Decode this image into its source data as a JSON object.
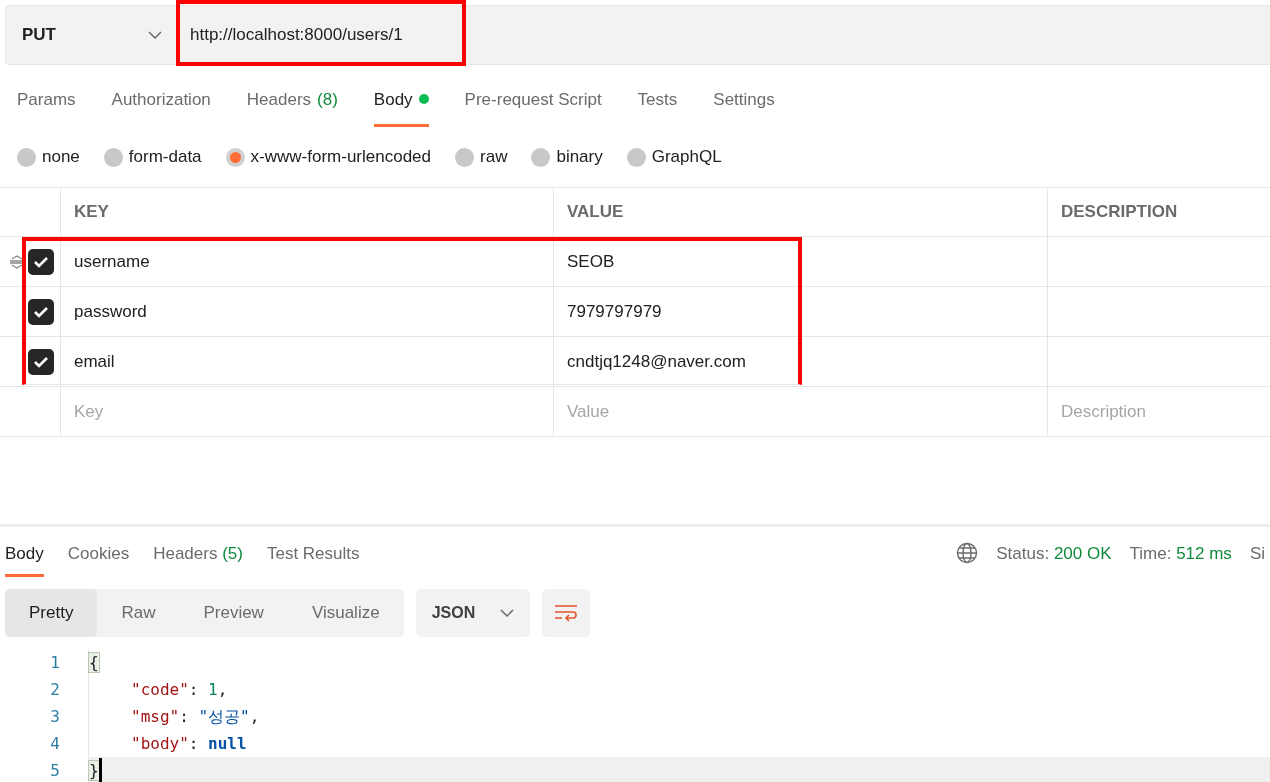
{
  "request": {
    "method": "PUT",
    "url": "http://localhost:8000/users/1",
    "url_highlighted": true
  },
  "request_tabs": [
    {
      "label": "Params",
      "selected": false
    },
    {
      "label": "Authorization",
      "selected": false
    },
    {
      "label": "Headers",
      "count": "(8)",
      "selected": false
    },
    {
      "label": "Body",
      "selected": true,
      "dot": true
    },
    {
      "label": "Pre-request Script",
      "selected": false
    },
    {
      "label": "Tests",
      "selected": false
    },
    {
      "label": "Settings",
      "selected": false
    }
  ],
  "body_types": [
    {
      "label": "none",
      "selected": false
    },
    {
      "label": "form-data",
      "selected": false
    },
    {
      "label": "x-www-form-urlencoded",
      "selected": true
    },
    {
      "label": "raw",
      "selected": false
    },
    {
      "label": "binary",
      "selected": false
    },
    {
      "label": "GraphQL",
      "selected": false
    }
  ],
  "params_table": {
    "columns": [
      "KEY",
      "VALUE",
      "DESCRIPTION"
    ],
    "rows": [
      {
        "key": "username",
        "value": "SEOB",
        "checked": true,
        "highlighted": true,
        "drag_handle": true
      },
      {
        "key": "password",
        "value": "7979797979",
        "checked": true,
        "highlighted": true,
        "drag_handle": false
      },
      {
        "key": "email",
        "value": "cndtjq1248@naver.com",
        "checked": true,
        "highlighted": true,
        "drag_handle": false
      }
    ],
    "new_row": {
      "key_placeholder": "Key",
      "value_placeholder": "Value",
      "description_placeholder": "Description"
    }
  },
  "response_tabs": [
    {
      "label": "Body",
      "selected": true
    },
    {
      "label": "Cookies",
      "selected": false
    },
    {
      "label": "Headers",
      "count": "(5)",
      "selected": false
    },
    {
      "label": "Test Results",
      "selected": false
    }
  ],
  "response_meta": [
    {
      "label": "Status:",
      "value": "200 OK"
    },
    {
      "label": "Time:",
      "value": "512 ms"
    },
    {
      "label": "Si"
    }
  ],
  "view_modes": [
    {
      "label": "Pretty",
      "selected": true
    },
    {
      "label": "Raw",
      "selected": false
    },
    {
      "label": "Preview",
      "selected": false
    },
    {
      "label": "Visualize",
      "selected": false
    }
  ],
  "format": "JSON",
  "code_lines": [
    {
      "number": "1",
      "indented": false,
      "current": false,
      "tokens": [
        {
          "kind": "bracket",
          "text": "{"
        }
      ]
    },
    {
      "number": "2",
      "indented": true,
      "current": false,
      "tokens": [
        {
          "kind": "key",
          "text": "\"code\""
        },
        {
          "kind": "punct",
          "text": ": "
        },
        {
          "kind": "number",
          "text": "1"
        },
        {
          "kind": "punct",
          "text": ","
        }
      ]
    },
    {
      "number": "3",
      "indented": true,
      "current": false,
      "tokens": [
        {
          "kind": "key",
          "text": "\"msg\""
        },
        {
          "kind": "punct",
          "text": ": "
        },
        {
          "kind": "string",
          "text": "\"성공\""
        },
        {
          "kind": "punct",
          "text": ","
        }
      ]
    },
    {
      "number": "4",
      "indented": true,
      "current": false,
      "tokens": [
        {
          "kind": "key",
          "text": "\"body\""
        },
        {
          "kind": "punct",
          "text": ": "
        },
        {
          "kind": "null",
          "text": "null"
        }
      ]
    },
    {
      "number": "5",
      "indented": false,
      "current": true,
      "tokens": [
        {
          "kind": "bracket",
          "text": "}"
        }
      ]
    }
  ]
}
